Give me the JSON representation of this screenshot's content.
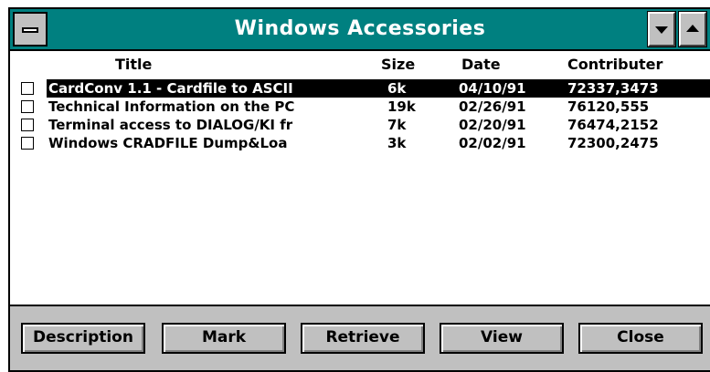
{
  "window": {
    "title": "Windows Accessories"
  },
  "columns": {
    "title": "Title",
    "size": "Size",
    "date": "Date",
    "contributor": "Contributer"
  },
  "rows": [
    {
      "title": "CardConv 1.1 - Cardfile to ASCII",
      "size": "6k",
      "date": "04/10/91",
      "contributor": "72337,3473",
      "selected": true
    },
    {
      "title": "Technical Information on the PC",
      "size": "19k",
      "date": "02/26/91",
      "contributor": "76120,555",
      "selected": false
    },
    {
      "title": "Terminal access to DIALOG/KI fr",
      "size": "7k",
      "date": "02/20/91",
      "contributor": "76474,2152",
      "selected": false
    },
    {
      "title": "Windows CRADFILE Dump&Loa",
      "size": "3k",
      "date": "02/02/91",
      "contributor": "72300,2475",
      "selected": false
    }
  ],
  "buttons": {
    "description": "Description",
    "mark": "Mark",
    "retrieve": "Retrieve",
    "view": "View",
    "close": "Close"
  },
  "colors": {
    "titlebar": "#008080",
    "button_face": "#c0c0c0",
    "selection": "#000000"
  }
}
